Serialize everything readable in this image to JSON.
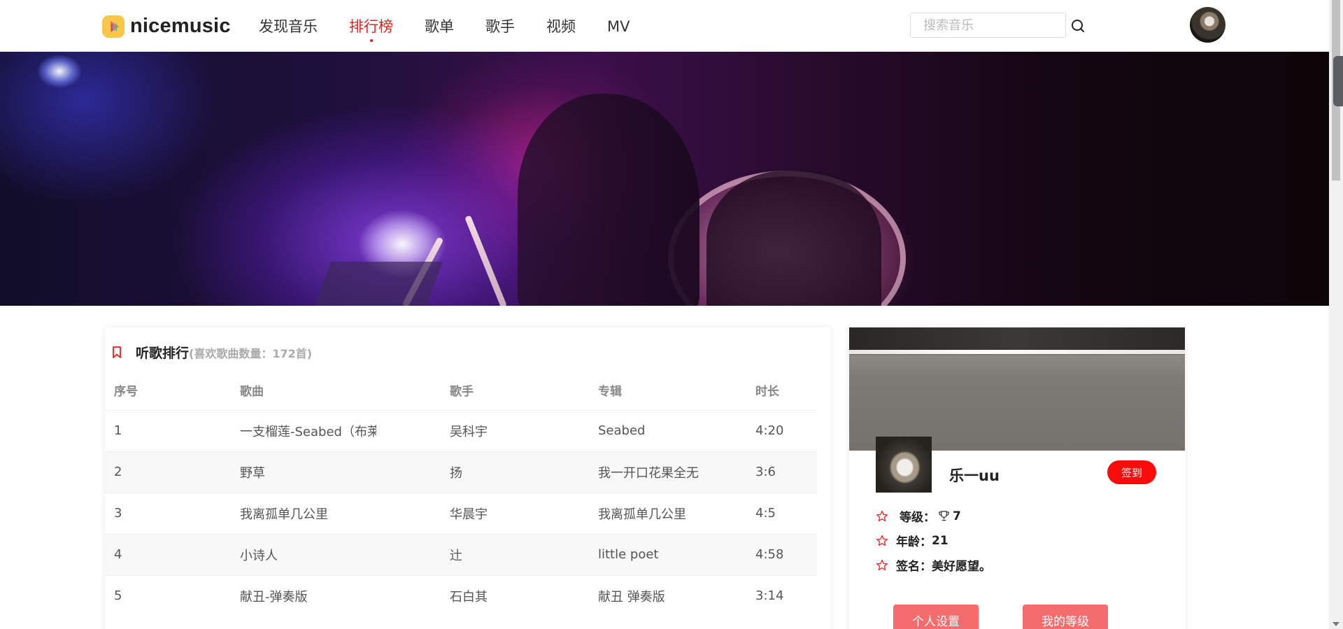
{
  "header": {
    "logo_text": "nicemusic",
    "nav": [
      {
        "label": "发现音乐",
        "active": false
      },
      {
        "label": "排行榜",
        "active": true
      },
      {
        "label": "歌单",
        "active": false
      },
      {
        "label": "歌手",
        "active": false
      },
      {
        "label": "视频",
        "active": false
      },
      {
        "label": "MV",
        "active": false
      }
    ],
    "search_placeholder": "搜索音乐",
    "search_value": "",
    "icons": {
      "search": "search-icon",
      "avatar": "user-avatar"
    }
  },
  "ranking": {
    "title": "听歌排行",
    "subtitle": "(喜欢歌曲数量：172首)",
    "icon": "bookmark-icon",
    "columns": [
      "序号",
      "歌曲",
      "歌手",
      "专辑",
      "时长"
    ],
    "rows": [
      {
        "no": "1",
        "song": "一支榴莲-Seabed（布莱",
        "artist": "吴科宇",
        "album": "Seabed",
        "duration": "4:20"
      },
      {
        "no": "2",
        "song": "野草",
        "artist": "扬",
        "album": "我一开口花果全无",
        "duration": "3:6"
      },
      {
        "no": "3",
        "song": "我离孤单几公里",
        "artist": "华晨宇",
        "album": "我离孤单几公里",
        "duration": "4:5"
      },
      {
        "no": "4",
        "song": "小诗人",
        "artist": "辻",
        "album": "little poet",
        "duration": "4:58"
      },
      {
        "no": "5",
        "song": "献丑-弹奏版",
        "artist": "石白其",
        "album": "献丑 弹奏版",
        "duration": "3:14"
      }
    ]
  },
  "profile": {
    "name": "乐一uu",
    "signin_label": "签到",
    "level_label": "等级：",
    "level_value": "7",
    "age_label": "年龄：",
    "age_value": "21",
    "signature_label": "签名：",
    "signature_value": "美好愿望。",
    "settings_button": "个人设置",
    "my_level_button": "我的等级"
  },
  "colors": {
    "accent": "#e6211e",
    "signin": "#f70b0b",
    "action": "#f56c6c",
    "logo_yellow": "#f7c64a"
  }
}
